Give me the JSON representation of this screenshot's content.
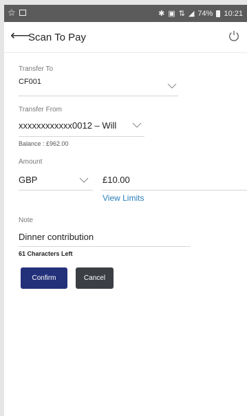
{
  "status_bar": {
    "battery": "74%",
    "time": "10:21",
    "icons": [
      "key-icon",
      "image-icon",
      "bluetooth-icon",
      "vibrate-icon",
      "data-icon",
      "signal-icon",
      "battery-icon"
    ]
  },
  "header": {
    "title": "Scan To Pay",
    "back_icon": "arrow-left-icon",
    "logout_icon": "power-icon"
  },
  "form": {
    "transfer_to": {
      "label": "Transfer To",
      "value": "CF001"
    },
    "transfer_from": {
      "label": "Transfer From",
      "value": "xxxxxxxxxxxx0012 – Will",
      "balance": "Balance : £962.00"
    },
    "amount": {
      "label": "Amount",
      "currency": "GBP",
      "value": "£10.00",
      "view_limits": "View Limits"
    },
    "note": {
      "label": "Note",
      "value": "Dinner contribution",
      "chars_left": "61 Characters Left"
    }
  },
  "actions": {
    "confirm": "Confirm",
    "cancel": "Cancel"
  },
  "colors": {
    "status_bar": "#5b5b5b",
    "primary_button": "#23307a",
    "secondary_button": "#3b3f44",
    "link": "#2a7fb8"
  }
}
